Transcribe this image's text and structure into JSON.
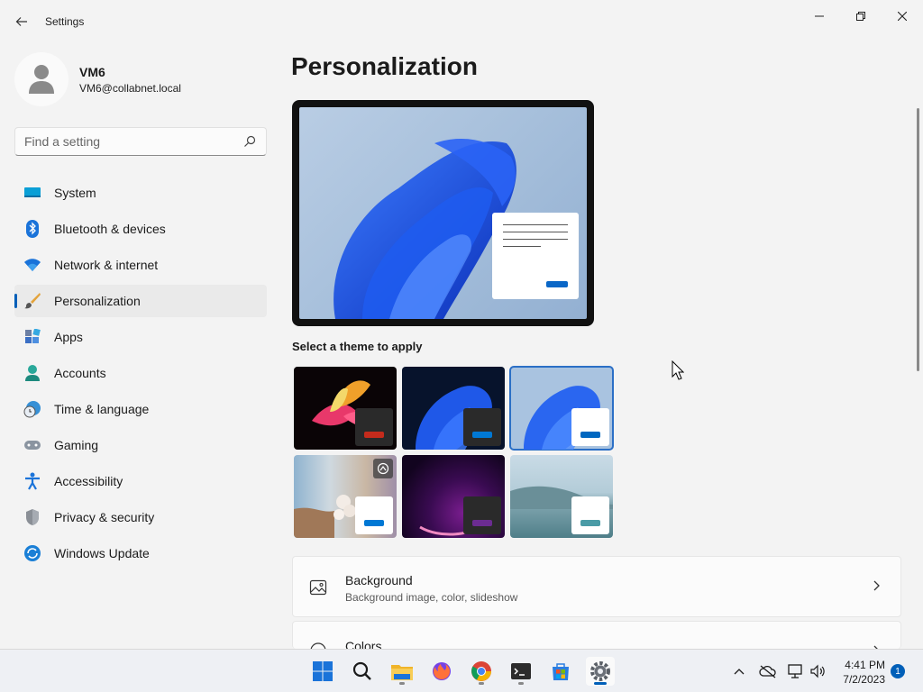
{
  "window": {
    "title": "Settings",
    "back_icon": "back-arrow-icon",
    "controls": [
      "minimize-icon",
      "maximize-icon",
      "close-icon"
    ]
  },
  "profile": {
    "name": "VM6",
    "email": "VM6@collabnet.local"
  },
  "search": {
    "placeholder": "Find a setting",
    "value": ""
  },
  "sidebar": {
    "items": [
      {
        "label": "System",
        "icon": "system-icon"
      },
      {
        "label": "Bluetooth & devices",
        "icon": "bluetooth-icon"
      },
      {
        "label": "Network & internet",
        "icon": "wifi-icon"
      },
      {
        "label": "Personalization",
        "icon": "paintbrush-icon",
        "active": true
      },
      {
        "label": "Apps",
        "icon": "apps-icon"
      },
      {
        "label": "Accounts",
        "icon": "accounts-icon"
      },
      {
        "label": "Time & language",
        "icon": "clock-globe-icon"
      },
      {
        "label": "Gaming",
        "icon": "gamepad-icon"
      },
      {
        "label": "Accessibility",
        "icon": "accessibility-icon"
      },
      {
        "label": "Privacy & security",
        "icon": "shield-icon"
      },
      {
        "label": "Windows Update",
        "icon": "update-icon"
      }
    ]
  },
  "main": {
    "title": "Personalization",
    "themes_label": "Select a theme to apply",
    "themes": [
      {
        "name": "theme-glow",
        "accent": "#c42b1c"
      },
      {
        "name": "theme-dark",
        "accent": "#0078d4"
      },
      {
        "name": "theme-light",
        "accent": "#0067c0",
        "selected": true
      },
      {
        "name": "theme-spotlight",
        "accent": "#0078d4"
      },
      {
        "name": "theme-captured-motion",
        "accent": "#6b2c91"
      },
      {
        "name": "theme-flow",
        "accent": "#4a9ba6"
      }
    ],
    "cards": [
      {
        "title": "Background",
        "subtitle": "Background image, color, slideshow",
        "icon": "image-icon"
      },
      {
        "title": "Colors",
        "subtitle": "",
        "icon": "palette-icon"
      }
    ]
  },
  "taskbar": {
    "time": "4:41 PM",
    "date": "7/2/2023",
    "notification_count": "1"
  },
  "colors": {
    "accent": "#005fb8",
    "background": "#f3f3f3",
    "card": "#fbfbfb"
  }
}
